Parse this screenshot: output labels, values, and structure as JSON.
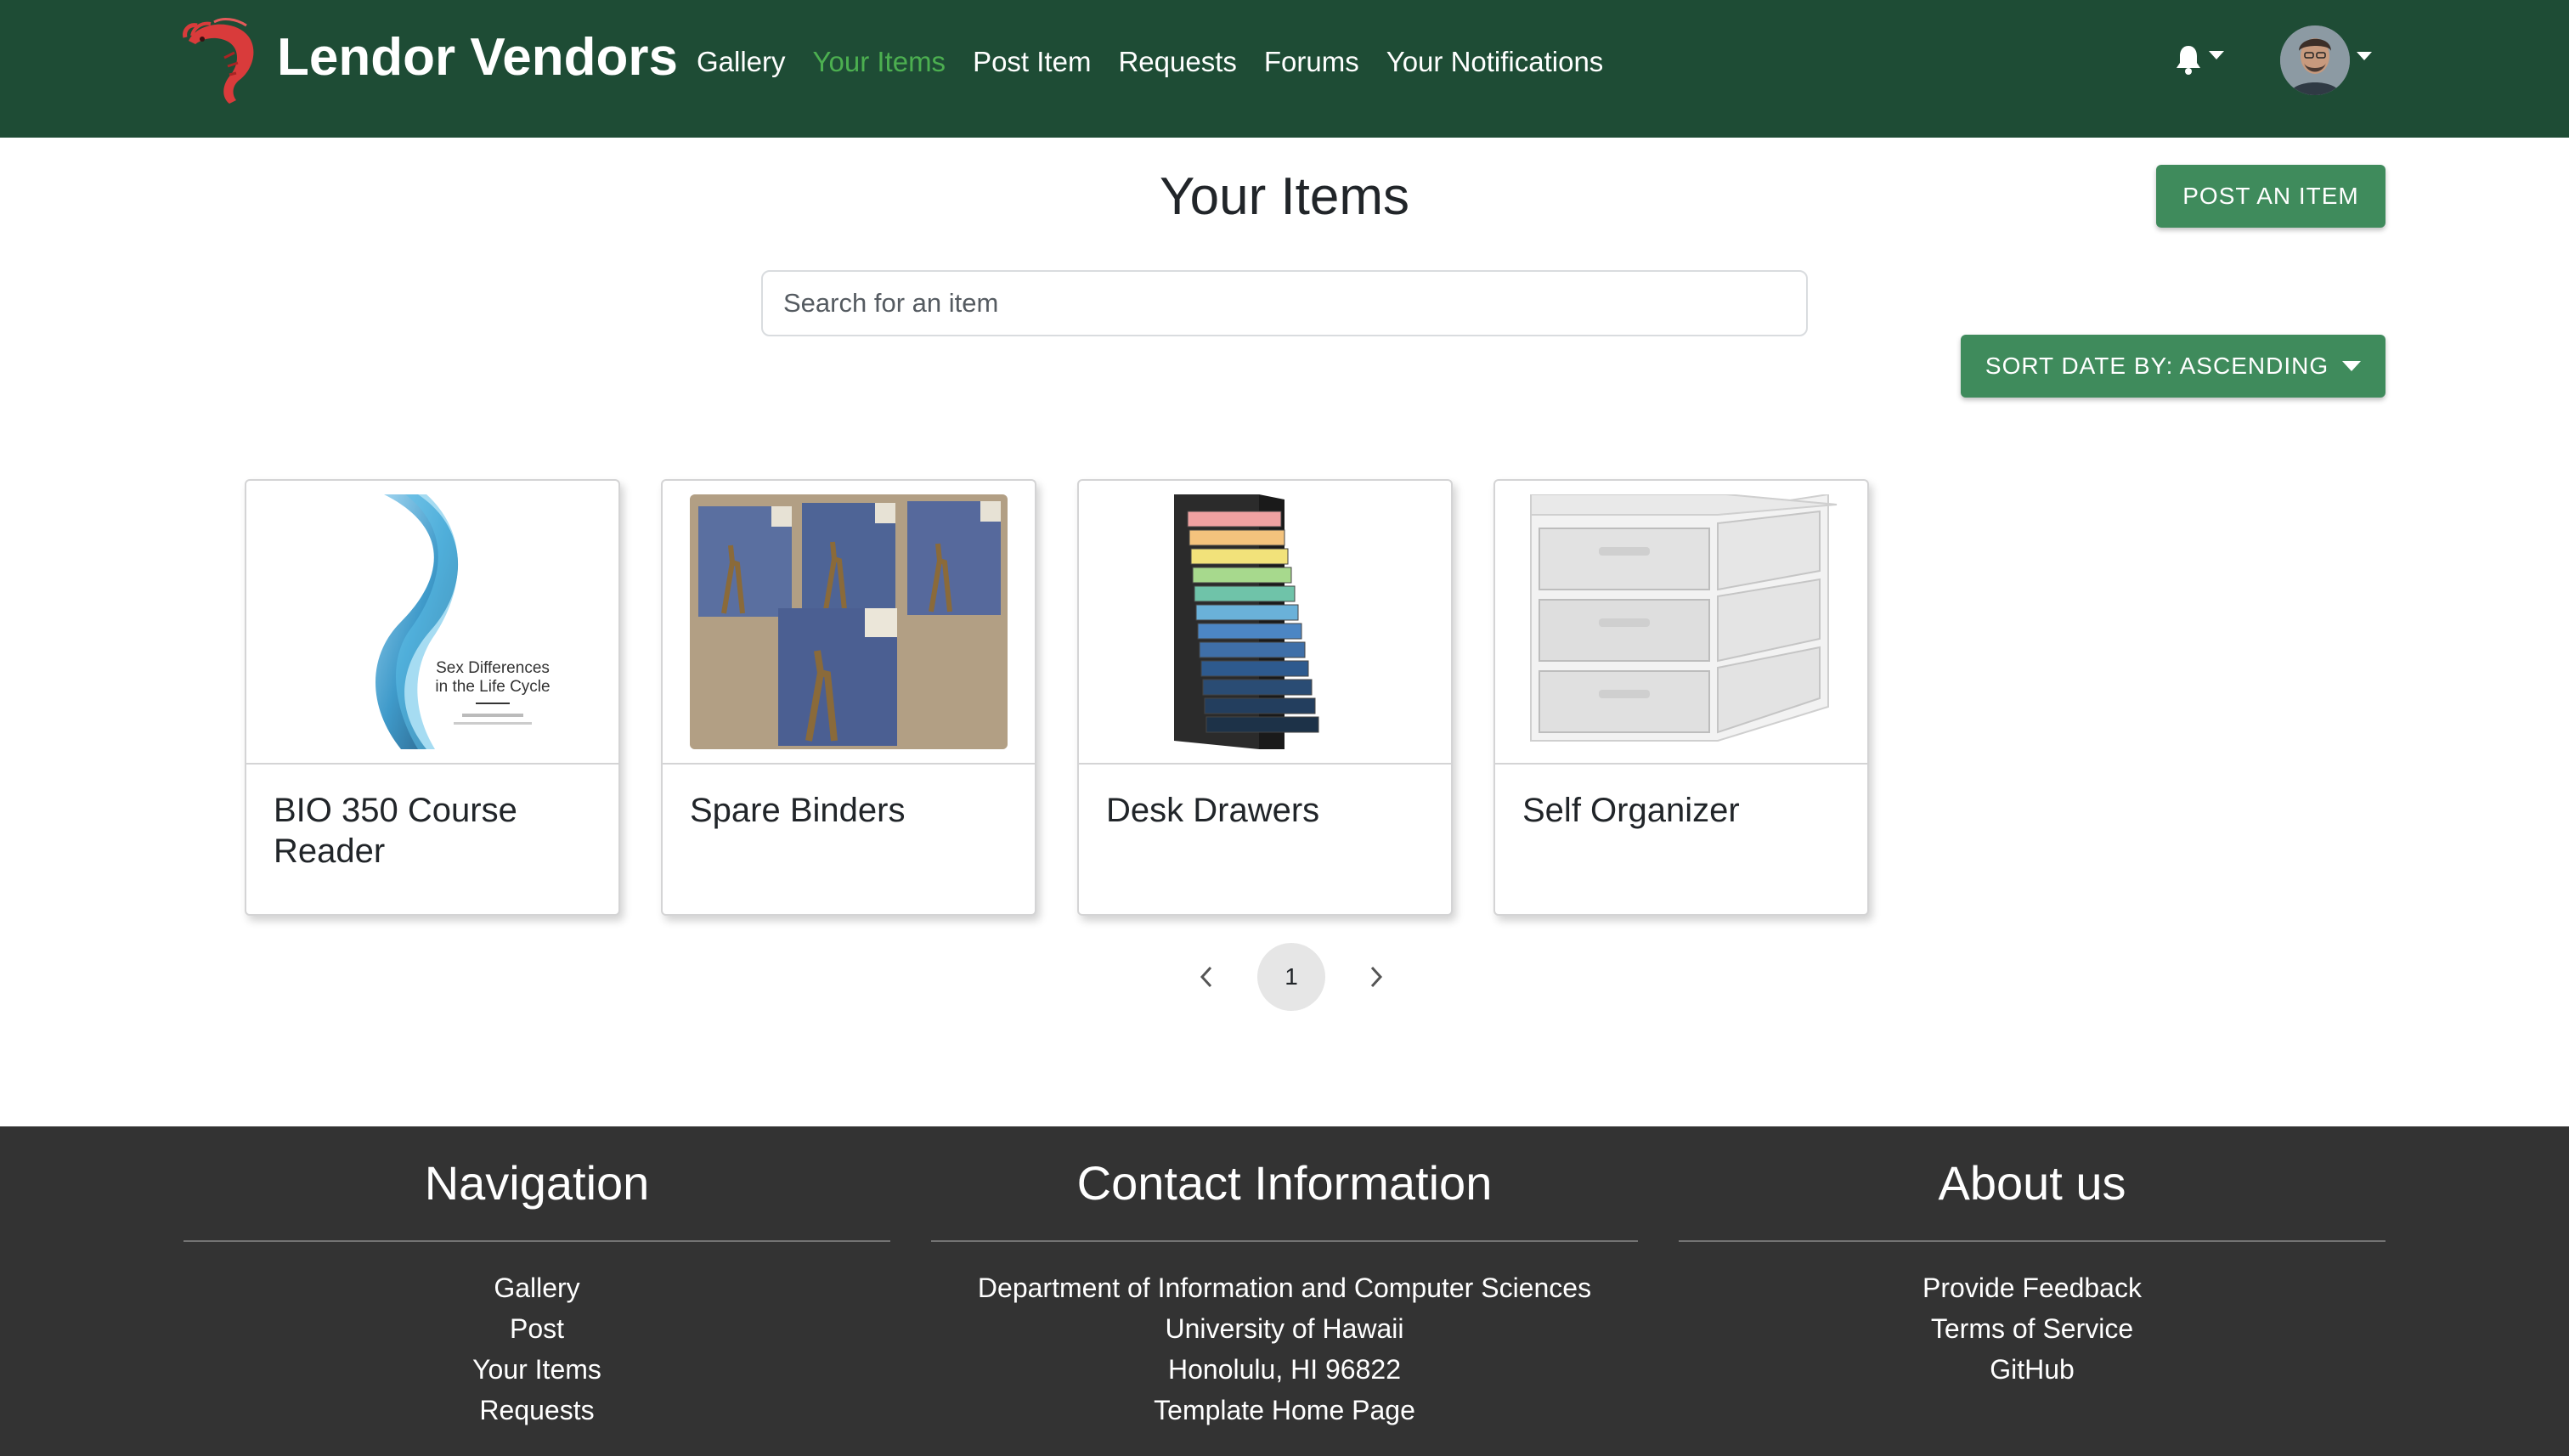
{
  "navbar": {
    "brand": "Lendor Vendors",
    "links": [
      {
        "label": "Gallery",
        "active": false
      },
      {
        "label": "Your Items",
        "active": true
      },
      {
        "label": "Post Item",
        "active": false
      },
      {
        "label": "Requests",
        "active": false
      },
      {
        "label": "Forums",
        "active": false
      },
      {
        "label": "Your Notifications",
        "active": false
      }
    ],
    "icons": {
      "logo": "shrimp-logo",
      "notifications": "bell-icon",
      "user": "avatar"
    }
  },
  "page": {
    "title": "Your Items",
    "post_button": "POST AN ITEM",
    "search_placeholder": "Search for an item",
    "sort_button": "SORT DATE BY: ASCENDING"
  },
  "items": [
    {
      "title": "BIO 350 Course Reader",
      "cover_line1": "Sex Differences",
      "cover_line2": "in the Life Cycle"
    },
    {
      "title": "Spare Binders"
    },
    {
      "title": "Desk Drawers"
    },
    {
      "title": "Self Organizer"
    }
  ],
  "pagination": {
    "current": "1"
  },
  "footer": {
    "navigation": {
      "heading": "Navigation",
      "links": [
        "Gallery",
        "Post",
        "Your Items",
        "Requests"
      ]
    },
    "contact": {
      "heading": "Contact Information",
      "lines": [
        "Department of Information and Computer Sciences",
        "University of Hawaii",
        "Honolulu, HI 96822"
      ],
      "link": "Template Home Page"
    },
    "about": {
      "heading": "About us",
      "links": [
        "Provide Feedback",
        "Terms of Service",
        "GitHub"
      ]
    }
  },
  "colors": {
    "navbar_bg": "#1e4c35",
    "accent_green": "#3f8b5c",
    "active_link": "#4caf50",
    "footer_bg": "#333333"
  }
}
